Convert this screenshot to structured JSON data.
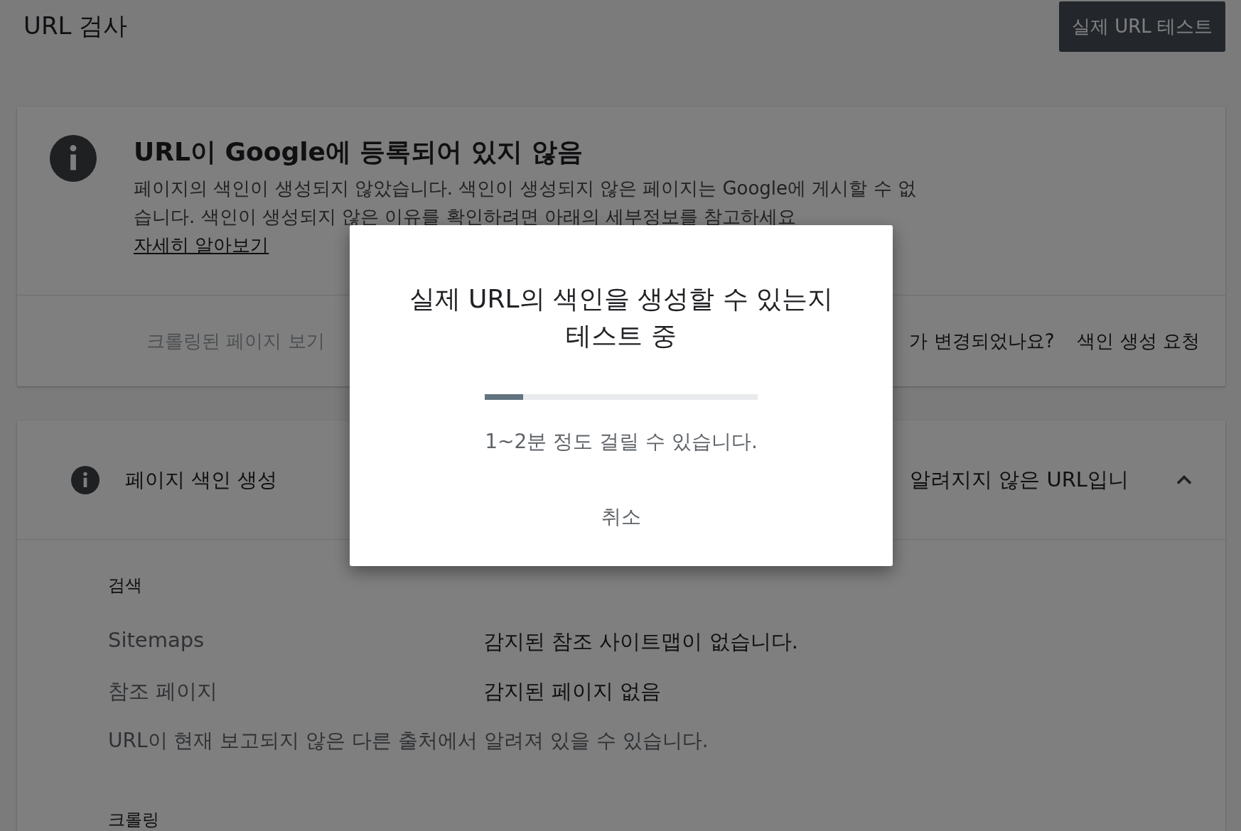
{
  "page": {
    "title": "URL 검사",
    "action_button": "실제 URL 테스트"
  },
  "status_card": {
    "headline": "URL이 Google에 등록되어 있지 않음",
    "description": "페이지의 색인이 생성되지 않았습니다. 색인이 생성되지 않은 페이지는 Google에 게시할 수 없습니다. 색인이 생성되지 않은 이유를 확인하려면 아래의 세부정보를 참고하세요",
    "link": "자세히 알아보기",
    "footer": {
      "crawled_page": {
        "label": "크롤링된 페이지 보기",
        "disabled": true
      },
      "question": "가 변경되었나요?",
      "request_indexing": "색인 생성 요청"
    }
  },
  "indexing_card": {
    "title": "페이지 색인 생성",
    "summary": "알려지지 않은 URL입니",
    "expanded": true,
    "sections": [
      {
        "heading": "검색",
        "rows": [
          {
            "label": "Sitemaps",
            "value": "감지된 참조 사이트맵이 없습니다."
          },
          {
            "label": "참조 페이지",
            "value": "감지된 페이지 없음"
          }
        ],
        "note": "URL이 현재 보고되지 않은 다른 출처에서 알려져 있을 수 있습니다."
      },
      {
        "heading": "크롤링"
      }
    ]
  },
  "dialog": {
    "title": "실제 URL의 색인을 생성할 수 있는지 테스트 중",
    "progress": {
      "level": 0.14
    },
    "message": "1~2분 정도 걸릴 수 있습니다.",
    "cancel_button": "취소"
  }
}
